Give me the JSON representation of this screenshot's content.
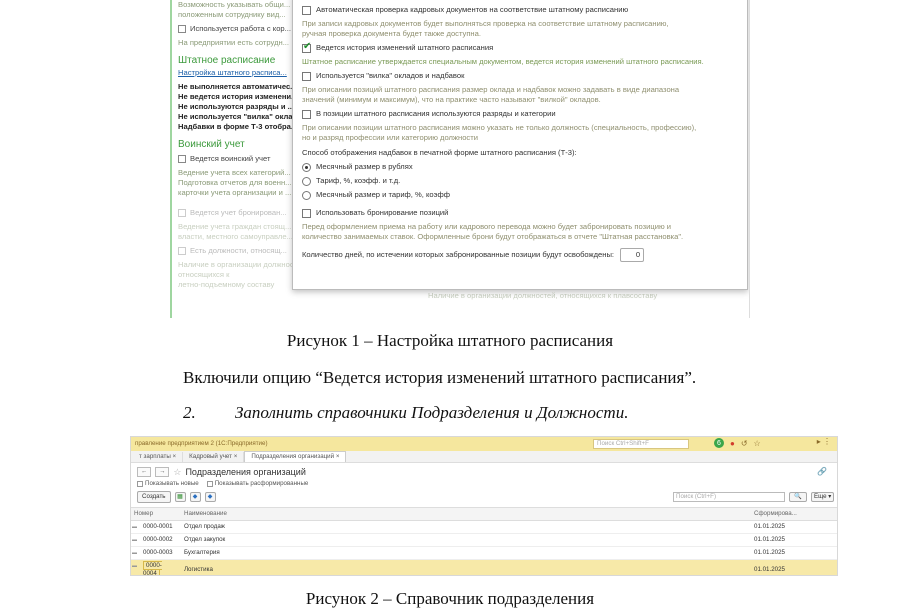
{
  "shot1": {
    "background": {
      "note1": "Возможность указывать общи...",
      "note2": "положенным сотруднику вид...",
      "check_corr": "Используется работа с кор...",
      "note3": "На предприятии есть сотрудн...",
      "section_staff": "Штатное расписание",
      "link_staff": "Настройка штатного расписа...",
      "bold_lines": [
        "Не выполняется автоматичес...",
        "Не ведется история изменени...",
        "Не используются разряды и ...",
        "Не используется \"вилка\" оклад...",
        "Надбавки в форме Т-3 отобра..."
      ],
      "section_military": "Воинский учет",
      "check_military": "Ведется воинский учет",
      "notes_military": [
        "Ведение учета всех категорий...",
        "Подготовка отчетов для военн...",
        "карточки учета организации и ..."
      ],
      "check_booking": "Ведется учет бронирован...",
      "notes_booking": [
        "Ведение учета граждан стоящ...",
        "власти, местного самоуправле..."
      ],
      "check_positions": "Есть должности, относящ...",
      "notes_positions": [
        "Наличие в организации должностей, относящихся к",
        "летно-подъемному составу"
      ],
      "bottom_note": "Наличие в организации должностей, относящихся к плавсоставу"
    },
    "popup": {
      "opt_auto_check": "Автоматическая проверка кадровых документов на соответствие штатному расписанию",
      "note_auto_check": [
        "При записи кадровых документов будет выполняться проверка на соответствие штатному расписанию,",
        "ручная проверка документа будет также доступна."
      ],
      "opt_history": "Ведется история изменений штатного расписания",
      "note_history": "Штатное расписание утверждается специальным документом, ведется история изменений штатного расписания.",
      "opt_fork": "Используется \"вилка\" окладов и надбавок",
      "note_fork": [
        "При описании позиций штатного расписания размер оклада и надбавок можно задавать в виде диапазона",
        "значений (минимум и максимум), что на практике часто называют \"вилкой\" окладов."
      ],
      "opt_ranks": "В позиции штатного расписания используются разряды и категории",
      "note_ranks": [
        "При описании позиции штатного расписания можно указать не только должность (специальность, профессию),",
        "но и разряд профессии или категорию должности"
      ],
      "display_label": "Способ отображения надбавок в печатной форме штатного расписания (Т-3):",
      "radios": [
        "Месячный размер в рублях",
        "Тариф, %, коэфф. и т.д.",
        "Месячный размер и тариф, %, коэфф"
      ],
      "opt_booking": "Использовать бронирование позиций",
      "note_booking": [
        "Перед оформлением приема на работу или кадрового перевода можно будет забронировать позицию и",
        "количество занимаемых ставок. Оформленные брони будут отображаться в отчете \"Штатная расстановка\"."
      ],
      "days_label": "Количество дней, по истечении которых забронированные позиции будут освобождены:",
      "days_value": "0"
    }
  },
  "caption1": "Рисунок 1 – Настройка штатного расписания",
  "paragraph": "Включили опцию “Ведется история изменений штатного расписания”.",
  "item2": {
    "number": "2.",
    "text": "Заполнить справочники Подразделения и Должности."
  },
  "shot2": {
    "app_title": "правление предприятием 2  (1С:Предприятие)",
    "search_placeholder": "Поиск Ctrl+Shift+F",
    "tabs": [
      "т зарплаты ×",
      "Кадровый учет ×",
      "Подразделения организаций ×"
    ],
    "nav_back": "←",
    "nav_fwd": "→",
    "page_title": "Подразделения организаций",
    "filter_new": "Показывать новые",
    "filter_disbanded": "Показывать расформированные",
    "btn_create": "Создать",
    "list_search": "Поиск (Ctrl+F)",
    "btn_more": "Еще ▾",
    "columns": [
      "Номер",
      "Наименование",
      "Сформирова..."
    ],
    "rows": [
      {
        "code": "0000-0001",
        "name": "Отдел продаж",
        "date": "01.01.2025"
      },
      {
        "code": "0000-0002",
        "name": "Отдел закупок",
        "date": "01.01.2025"
      },
      {
        "code": "0000-0003",
        "name": "Бухгалтерия",
        "date": "01.01.2025"
      },
      {
        "code": "0000-0004",
        "name": "Логистика",
        "date": "01.01.2025"
      }
    ]
  },
  "caption2": "Рисунок 2 – Справочник подразделения"
}
